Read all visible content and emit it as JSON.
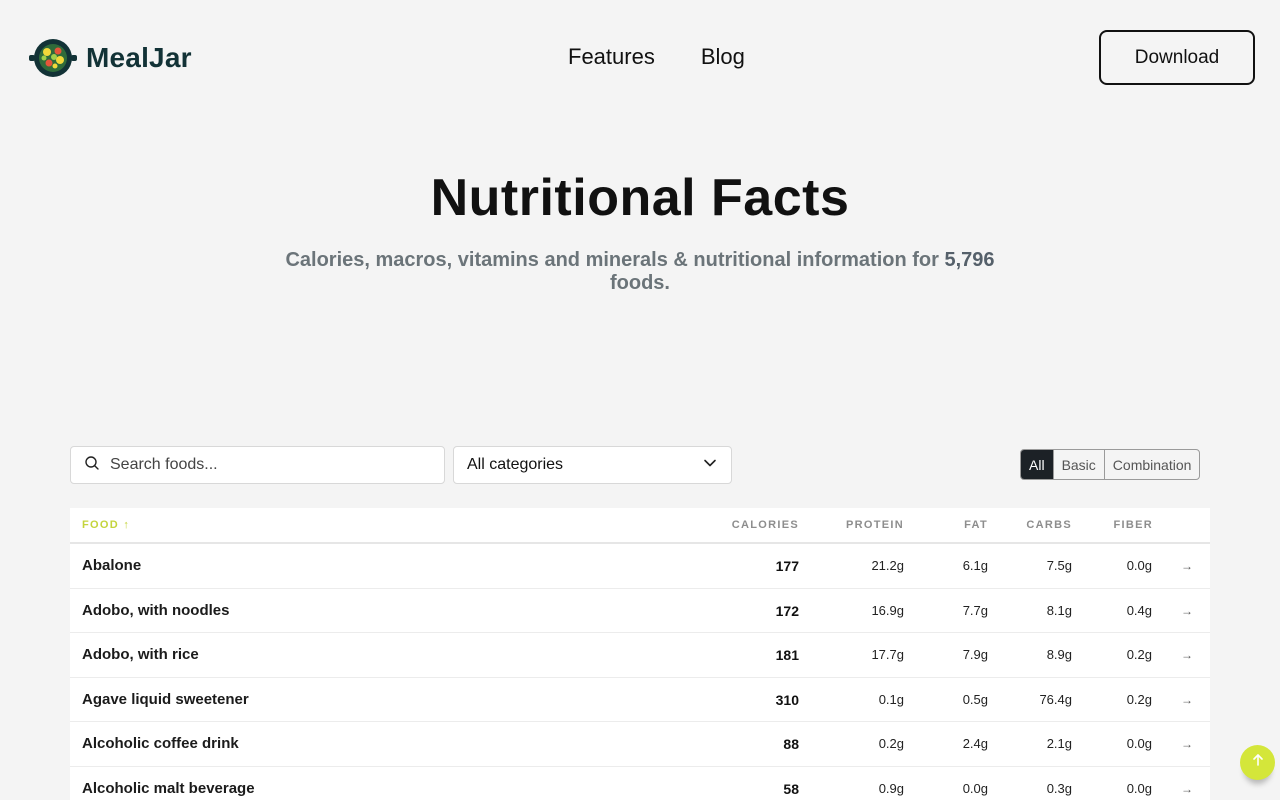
{
  "brand": {
    "name": "MealJar"
  },
  "nav": {
    "features": "Features",
    "blog": "Blog"
  },
  "header": {
    "download_label": "Download"
  },
  "hero": {
    "title": "Nutritional Facts",
    "subtitle_prefix": "Calories, macros, vitamins and minerals & nutritional information for ",
    "count": "5,796",
    "subtitle_suffix": " foods."
  },
  "search": {
    "placeholder": "Search foods...",
    "value": ""
  },
  "category": {
    "selected": "All categories"
  },
  "filter": {
    "options": [
      "All",
      "Basic",
      "Combination"
    ],
    "active": "All"
  },
  "table": {
    "headers": {
      "food": "FOOD ↑",
      "calories": "CALORIES",
      "protein": "PROTEIN",
      "fat": "FAT",
      "carbs": "CARBS",
      "fiber": "FIBER"
    },
    "rows": [
      {
        "name": "Abalone",
        "calories": "177",
        "protein": "21.2g",
        "fat": "6.1g",
        "carbs": "7.5g",
        "fiber": "0.0g",
        "arrow": "→"
      },
      {
        "name": "Adobo, with noodles",
        "calories": "172",
        "protein": "16.9g",
        "fat": "7.7g",
        "carbs": "8.1g",
        "fiber": "0.4g",
        "arrow": "→"
      },
      {
        "name": "Adobo, with rice",
        "calories": "181",
        "protein": "17.7g",
        "fat": "7.9g",
        "carbs": "8.9g",
        "fiber": "0.2g",
        "arrow": "→"
      },
      {
        "name": "Agave liquid sweetener",
        "calories": "310",
        "protein": "0.1g",
        "fat": "0.5g",
        "carbs": "76.4g",
        "fiber": "0.2g",
        "arrow": "→"
      },
      {
        "name": "Alcoholic coffee drink",
        "calories": "88",
        "protein": "0.2g",
        "fat": "2.4g",
        "carbs": "2.1g",
        "fiber": "0.0g",
        "arrow": "→"
      },
      {
        "name": "Alcoholic malt beverage",
        "calories": "58",
        "protein": "0.9g",
        "fat": "0.0g",
        "carbs": "0.3g",
        "fiber": "0.0g",
        "arrow": "→"
      }
    ]
  },
  "colors": {
    "accent": "#d4e63a",
    "brand_text": "#123236",
    "dark": "#1c2126"
  },
  "icons": {
    "logo": "salad-bowl-icon",
    "search": "search-icon",
    "dropdown": "chevron-down-icon",
    "scroll_top": "arrow-up-icon"
  }
}
